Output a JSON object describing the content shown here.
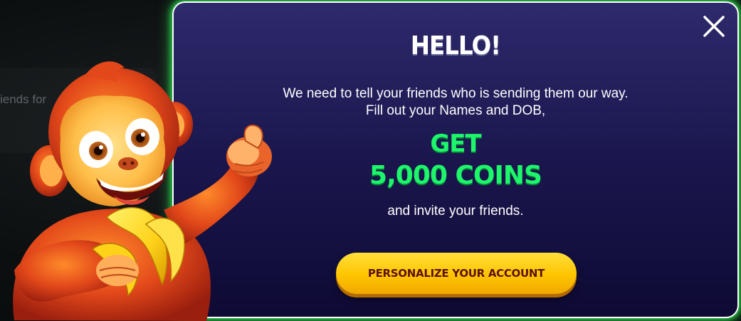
{
  "background": {
    "partial_text": "iends for"
  },
  "modal": {
    "title": "HELLO!",
    "message_line1": "We need to tell your friends who is sending them our way.",
    "message_line2": "Fill out your Names and DOB,",
    "highlight_line1": "GET",
    "highlight_line2": "5,000 COINS",
    "message_line3": "and invite your friends.",
    "cta_label": "PERSONALIZE YOUR ACCOUNT",
    "close_icon": "close-icon",
    "mascot": "monkey-mascot-illustration"
  },
  "colors": {
    "modal_bg_top": "#2e2a6c",
    "modal_bg_bottom": "#0e0a34",
    "glow": "#2bd14a",
    "highlight": "#1df56b",
    "cta_bg": "#ffc400",
    "cta_text": "#5a1206"
  }
}
